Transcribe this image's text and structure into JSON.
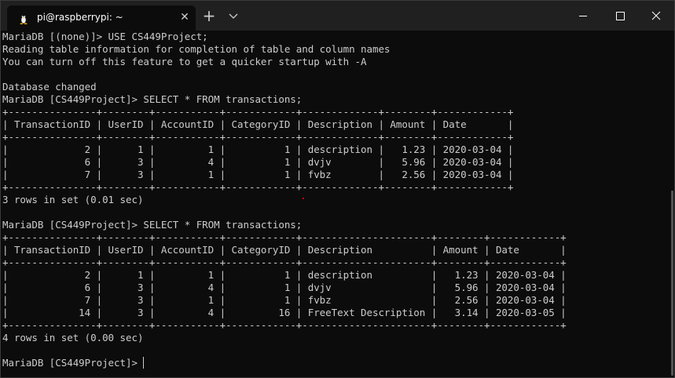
{
  "window": {
    "tab_title": "pi@raspberrypi: ~",
    "icons": {
      "tab_icon": "linux-penguin-icon",
      "tab_close": "close-icon",
      "new_tab": "plus-icon",
      "dropdown": "chevron-down-icon",
      "minimize": "minimize-icon",
      "maximize": "maximize-icon",
      "close": "close-icon"
    },
    "glyphs": {
      "close": "✕",
      "plus": "+"
    }
  },
  "colors": {
    "background": "#0c0c0c",
    "foreground": "#cccccc",
    "titlebar": "#202020"
  },
  "terminal": {
    "lines": [
      "MariaDB [(none)]> USE CS449Project;",
      "Reading table information for completion of table and column names",
      "You can turn off this feature to get a quicker startup with -A",
      "",
      "Database changed",
      "MariaDB [CS449Project]> SELECT * FROM transactions;",
      "+---------------+--------+-----------+------------+-------------+--------+------------+",
      "| TransactionID | UserID | AccountID | CategoryID | Description | Amount | Date       |",
      "+---------------+--------+-----------+------------+-------------+--------+------------+",
      "|             2 |      1 |         1 |          1 | description |   1.23 | 2020-03-04 |",
      "|             6 |      3 |         4 |          1 | dvjv        |   5.96 | 2020-03-04 |",
      "|             7 |      3 |         1 |          1 | fvbz        |   2.56 | 2020-03-04 |",
      "+---------------+--------+-----------+------------+-------------+--------+------------+",
      "3 rows in set (0.01 sec)",
      "",
      "MariaDB [CS449Project]> SELECT * FROM transactions;",
      "+---------------+--------+-----------+------------+----------------------+--------+------------+",
      "| TransactionID | UserID | AccountID | CategoryID | Description          | Amount | Date       |",
      "+---------------+--------+-----------+------------+----------------------+--------+------------+",
      "|             2 |      1 |         1 |          1 | description          |   1.23 | 2020-03-04 |",
      "|             6 |      3 |         4 |          1 | dvjv                 |   5.96 | 2020-03-04 |",
      "|             7 |      3 |         1 |          1 | fvbz                 |   2.56 | 2020-03-04 |",
      "|            14 |      3 |         4 |         16 | FreeText Description |   3.14 | 2020-03-05 |",
      "+---------------+--------+-----------+------------+----------------------+--------+------------+",
      "4 rows in set (0.00 sec)",
      "",
      "MariaDB [CS449Project]> "
    ]
  }
}
